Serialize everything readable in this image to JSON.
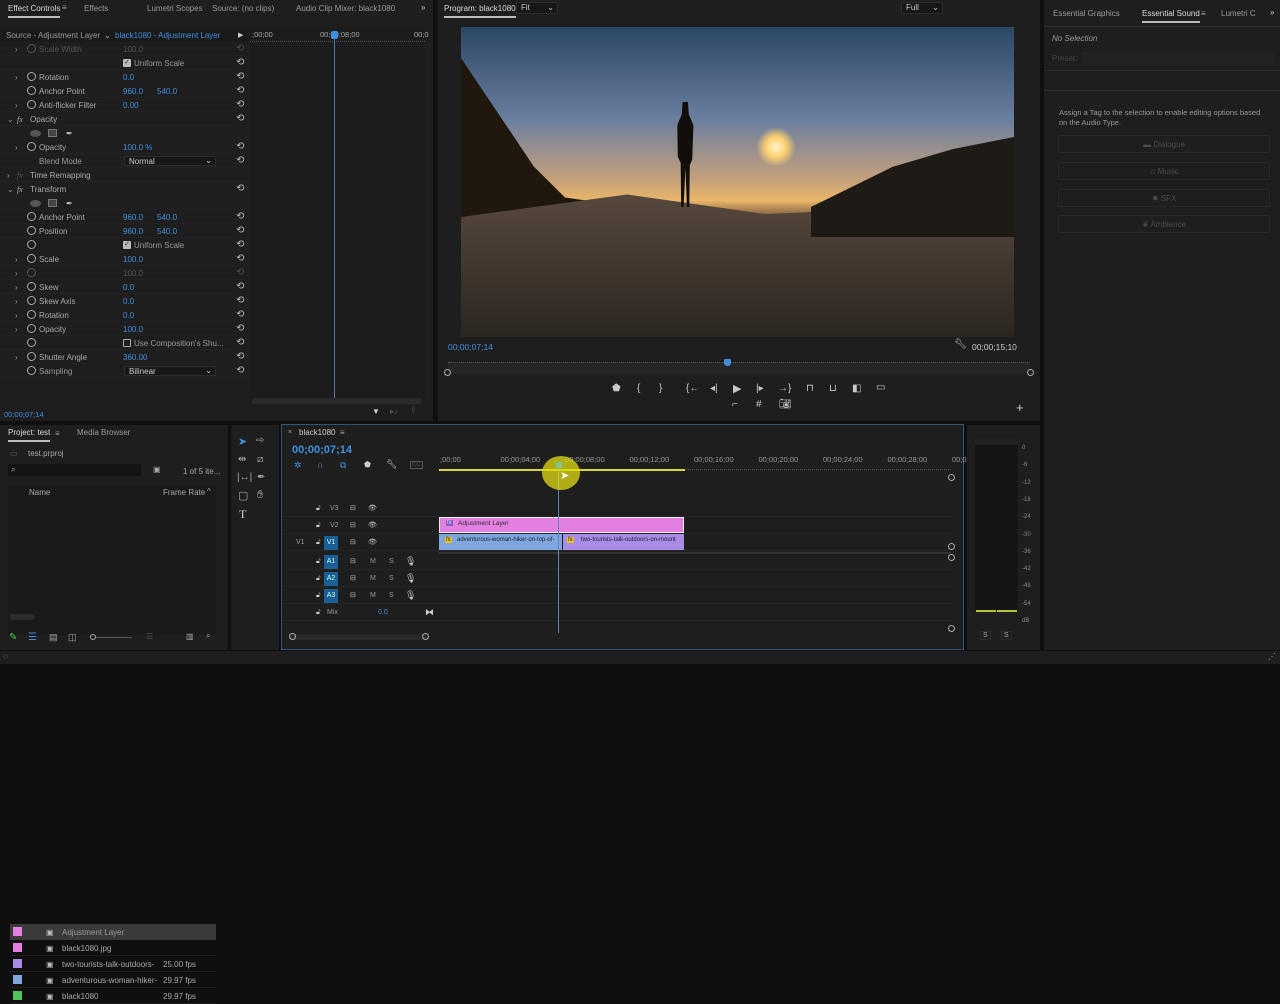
{
  "effect_controls": {
    "tabs": [
      "Effect Controls",
      "Effects",
      "Lumetri Scopes",
      "Source: (no clips)",
      "Audio Clip Mixer: black1080"
    ],
    "source_label": "Source - Adjustment Layer",
    "clip_label": "black1080 - Adjustment Layer",
    "mini_timeline": {
      "start": ";00;00",
      "mid": "00;00;08;00",
      "end": "00;0"
    },
    "rows": [
      {
        "type": "prop",
        "chev": true,
        "stop": true,
        "dim": true,
        "label": "Scale Width",
        "v1": "100.0"
      },
      {
        "type": "check",
        "checked": true,
        "label": "Uniform Scale"
      },
      {
        "type": "prop",
        "chev": true,
        "stop": true,
        "label": "Rotation",
        "v1": "0.0"
      },
      {
        "type": "prop",
        "stop": true,
        "label": "Anchor Point",
        "v1": "960.0",
        "v2": "540.0"
      },
      {
        "type": "prop",
        "chev": true,
        "stop": true,
        "label": "Anti-flicker Filter",
        "v1": "0.00"
      },
      {
        "type": "fx",
        "label": "Opacity"
      },
      {
        "type": "masks"
      },
      {
        "type": "prop",
        "chev": true,
        "stop": true,
        "label": "Opacity",
        "v1": "100.0 %"
      },
      {
        "type": "select",
        "label": "Blend Mode",
        "value": "Normal"
      },
      {
        "type": "fx",
        "label": "Time Remapping",
        "closed": true,
        "noreset": true
      },
      {
        "type": "fx",
        "label": "Transform"
      },
      {
        "type": "masks"
      },
      {
        "type": "prop",
        "stop": true,
        "label": "Anchor Point",
        "v1": "960.0",
        "v2": "540.0"
      },
      {
        "type": "prop",
        "stop": true,
        "label": "Position",
        "v1": "960.0",
        "v2": "540.0"
      },
      {
        "type": "check",
        "stop": true,
        "checked": true,
        "label": "Uniform Scale"
      },
      {
        "type": "prop",
        "chev": true,
        "stop": true,
        "label": "Scale",
        "v1": "100.0"
      },
      {
        "type": "prop",
        "chev": true,
        "stop": true,
        "dim": true,
        "label": "",
        "v1": "100.0"
      },
      {
        "type": "prop",
        "chev": true,
        "stop": true,
        "label": "Skew",
        "v1": "0.0"
      },
      {
        "type": "prop",
        "chev": true,
        "stop": true,
        "label": "Skew Axis",
        "v1": "0.0"
      },
      {
        "type": "prop",
        "chev": true,
        "stop": true,
        "label": "Rotation",
        "v1": "0.0"
      },
      {
        "type": "prop",
        "chev": true,
        "stop": true,
        "label": "Opacity",
        "v1": "100.0"
      },
      {
        "type": "check",
        "stop": true,
        "checked": false,
        "label": "Use Composition's Shu..."
      },
      {
        "type": "prop",
        "chev": true,
        "stop": true,
        "label": "Shutter Angle",
        "v1": "360.00"
      },
      {
        "type": "select",
        "stop": true,
        "label": "Sampling",
        "value": "Bilinear"
      }
    ],
    "timecode": "00;00;07;14"
  },
  "program": {
    "title": "Program: black1080",
    "timecode": "00;00;07;14",
    "fit": "Fit",
    "quality": "Full",
    "duration": "00;00;15;10",
    "playhead_fraction": 0.48
  },
  "essential_sound": {
    "tabs": [
      "Essential Graphics",
      "Essential Sound",
      "Lumetri C"
    ],
    "no_selection": "No Selection",
    "preset_label": "Preset:",
    "hint": "Assign a Tag to the selection to enable editing options based on the Audio Type.",
    "buttons": [
      "Dialogue",
      "Music",
      "SFX",
      "Ambience"
    ]
  },
  "project": {
    "tabs": [
      "Project: test",
      "Media Browser"
    ],
    "file": "test.prproj",
    "count": "1 of 5 ite...",
    "columns": [
      "Name",
      "Frame Rate"
    ],
    "items": [
      {
        "name": "Adjustment Layer",
        "fps": "",
        "color": "#e27fe0",
        "selected": true
      },
      {
        "name": "black1080.jpg",
        "fps": "",
        "color": "#e27fe0"
      },
      {
        "name": "two-tourists-talk-outdoors-",
        "fps": "25.00 fps",
        "color": "#a98be8"
      },
      {
        "name": "adventurous-woman-hiker-",
        "fps": "29.97 fps",
        "color": "#7fa6de"
      },
      {
        "name": "black1080",
        "fps": "29.97 fps",
        "color": "#4cc45a"
      }
    ]
  },
  "timeline": {
    "title": "black1080",
    "timecode": "00;00;07;14",
    "ruler": [
      ";00;00",
      "00;00;04;00",
      "00;00;08;00",
      "00;00;12;00",
      "00;00;16;00",
      "00;00;20;00",
      "00;00;24;00",
      "00;00;28;00",
      "00;0"
    ],
    "video_tracks": [
      "V3",
      "V2",
      "V1"
    ],
    "audio_tracks": [
      "A1",
      "A2",
      "A3"
    ],
    "source_patch": "V1",
    "mix_label": "Mix",
    "mix_value": "0.0",
    "clips": {
      "adjustment": "Adjustment Layer",
      "clip1": "adventurous-woman-hiker-on-top-of-",
      "clip2": "two-tourists-talk-outdoors-on-mount"
    },
    "mute": "M",
    "solo": "S"
  },
  "meter": {
    "scale": [
      "0",
      "-6",
      "-12",
      "-18",
      "-24",
      "-30",
      "-36",
      "-42",
      "-48",
      "-54",
      "dB"
    ],
    "solo": [
      "S",
      "S"
    ]
  }
}
